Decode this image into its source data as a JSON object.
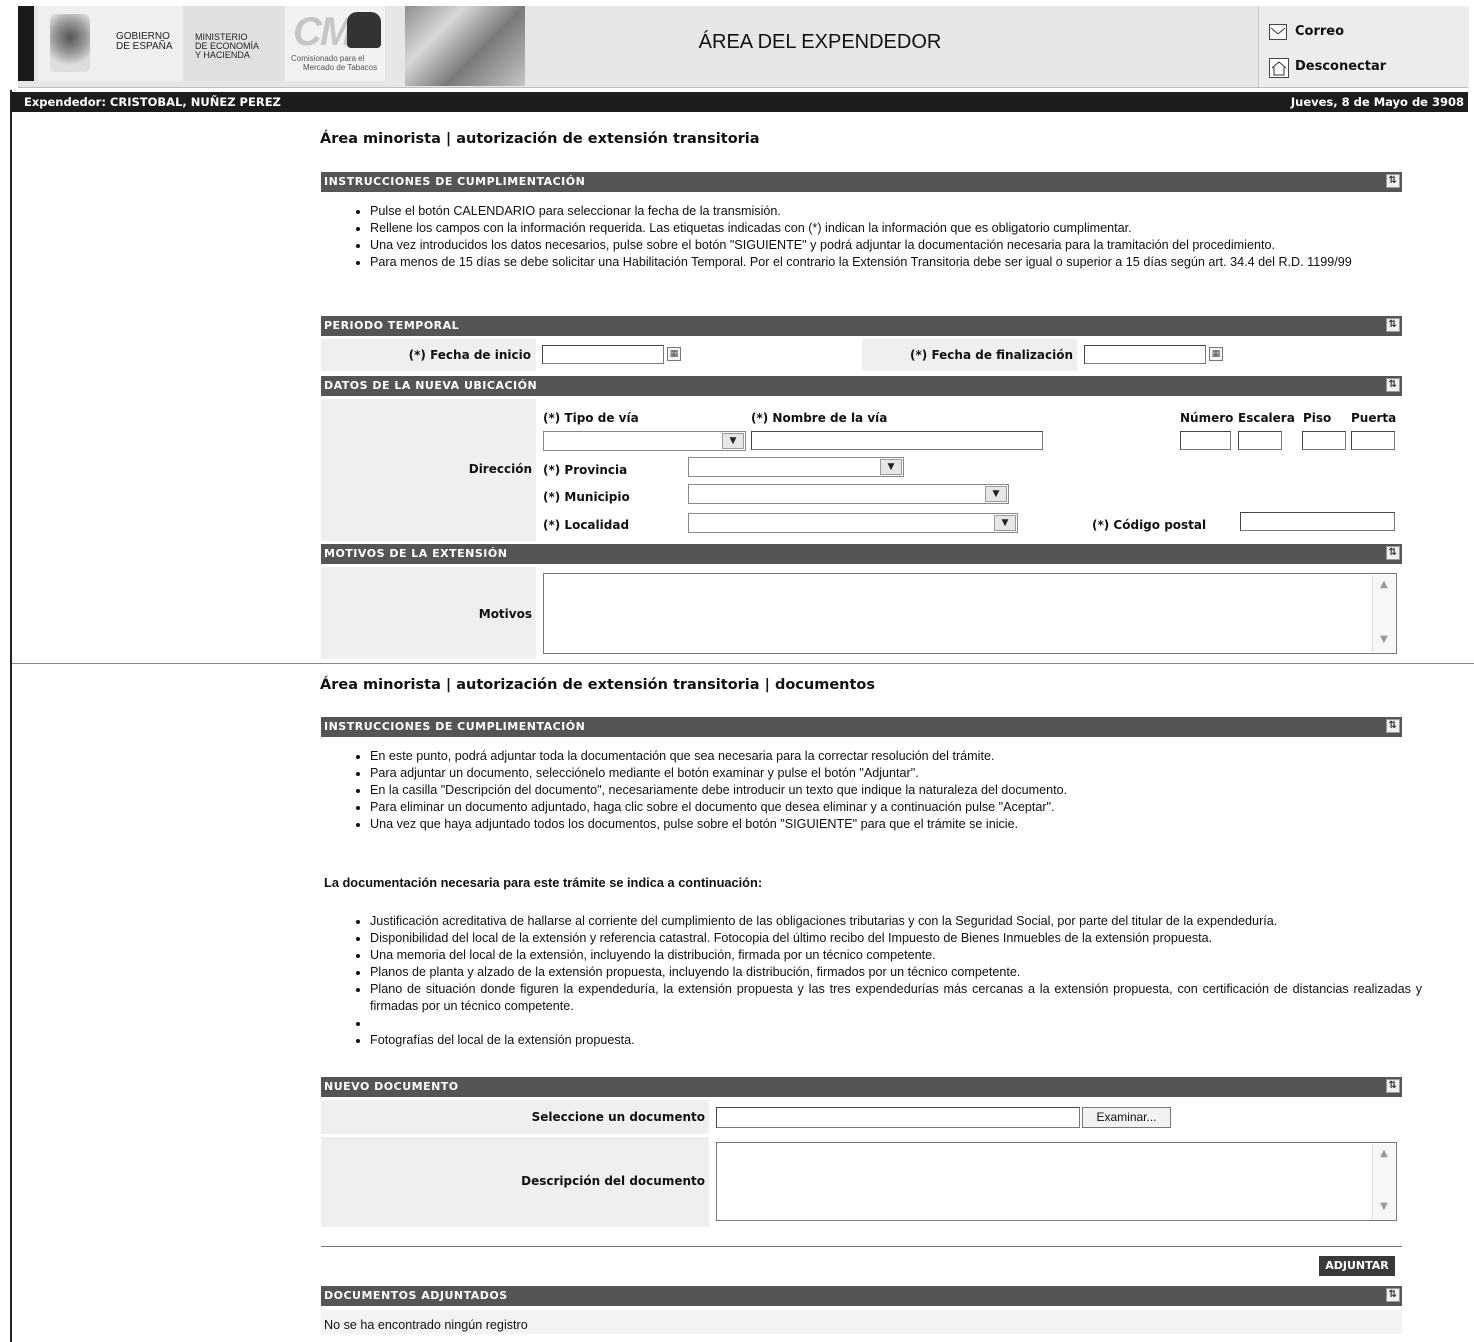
{
  "header": {
    "gobierno": [
      "GOBIERNO",
      "DE ESPAÑA"
    ],
    "ministerio": [
      "MINISTERIO",
      "DE ECONOMÍA",
      "Y HACIENDA"
    ],
    "cmt_short": "CM",
    "cmt_sub": [
      "Comisionado para el",
      "Mercado de Tabacos"
    ],
    "title": "ÁREA DEL EXPENDEDOR",
    "correo": "Correo",
    "desconectar": "Desconectar"
  },
  "userbar": {
    "expendedor": "Expendedor: CRISTOBAL, NUÑEZ PEREZ",
    "date": "Jueves, 8 de Mayo de 3908"
  },
  "page1": {
    "title": "Área minorista | autorización de extensión transitoria",
    "instructions_title": "INSTRUCCIONES DE CUMPLIMENTACIÓN",
    "instructions": [
      "Pulse el botón CALENDARIO para seleccionar la fecha de la transmisión.",
      "Rellene los campos con la información requerida. Las etiquetas indicadas con (*) indican la información que es obligatorio cumplimentar.",
      "Una vez introducidos los datos necesarios, pulse sobre el botón \"SIGUIENTE\" y podrá adjuntar la documentación necesaria para la tramitación del procedimiento.",
      "Para menos de 15 días se debe solicitar una Habilitación Temporal. Por el contrario la Extensión Transitoria debe ser igual o superior a 15 días según art. 34.4 del R.D. 1199/99"
    ],
    "periodo_title": "PERIODO TEMPORAL",
    "fecha_inicio": "(*) Fecha de inicio",
    "fecha_fin": "(*) Fecha de finalización",
    "ubicacion_title": "DATOS DE LA NUEVA UBICACIÓN",
    "direccion": "Dirección",
    "tipo_via": "(*) Tipo de vía",
    "tipo_via_value": "",
    "nombre_via": "(*) Nombre de la vía",
    "numero": "Número",
    "escalera": "Escalera",
    "piso": "Piso",
    "puerta": "Puerta",
    "provincia": "(*) Provincia",
    "municipio": "(*) Municipio",
    "localidad": "(*) Localidad",
    "codigo_postal": "(*) Código postal",
    "motivos_title": "MOTIVOS DE LA EXTENSIÓN",
    "motivos": "Motivos"
  },
  "page2": {
    "title": "Área minorista | autorización de extensión transitoria | documentos",
    "instructions_title": "INSTRUCCIONES DE CUMPLIMENTACIÓN",
    "instructions": [
      "En este punto, podrá adjuntar toda la documentación que sea necesaria para la correctar resolución del trámite.",
      "Para adjuntar un documento, selecciónelo mediante el botón examinar y pulse el botón \"Adjuntar\".",
      "En la casilla \"Descripción del documento\", necesariamente debe introducir un texto que indique la naturaleza del documento.",
      "Para eliminar un documento adjuntado, haga clic sobre el documento que desea eliminar y a continuación pulse \"Aceptar\".",
      "Una vez que haya adjuntado todos los documentos, pulse sobre el botón \"SIGUIENTE\" para que el trámite se inicie."
    ],
    "doc_intro": "La documentación necesaria para este trámite se indica a continuación:",
    "docs": [
      "Justificación acreditativa de hallarse al corriente del cumplimiento de las obligaciones tributarias y con la Seguridad Social, por parte del titular de la expendeduría.",
      "Disponibilidad del local de la extensión y referencia catastral. Fotocopia del último recibo del Impuesto de Bienes Inmuebles de la extensión propuesta.",
      "Una memoria del local de la extensión, incluyendo la distribución, firmada por un técnico competente.",
      "Planos de planta y alzado de la extensión propuesta, incluyendo la distribución, firmados por un técnico competente.",
      "Plano de situación donde figuren la expendeduría, la extensión propuesta y las tres expendedurías más cercanas a la extensión propuesta, con certificación de distancias realizadas y firmadas por un técnico competente.",
      "",
      "Fotografías del local de la extensión propuesta."
    ],
    "nuevo_title": "NUEVO DOCUMENTO",
    "seleccione": "Seleccione un documento",
    "examinar": "Examinar...",
    "descripcion": "Descripción del documento",
    "adjuntar": "ADJUNTAR",
    "adjuntados_title": "DOCUMENTOS ADJUNTADOS",
    "no_registro": "No se ha encontrado ningún registro"
  },
  "icons": {
    "toggle": "collapse-toggle-icon",
    "calendar": "calendar-icon",
    "mail": "mail-icon",
    "home": "home-icon"
  }
}
